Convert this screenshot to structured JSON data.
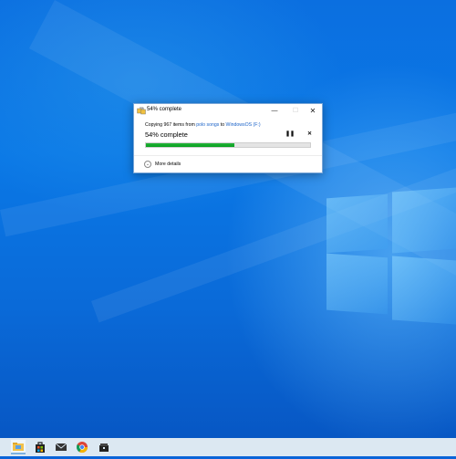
{
  "dialog": {
    "title": "54% complete",
    "minimize_glyph": "—",
    "maximize_glyph": "☐",
    "close_glyph": "✕",
    "copy_prefix": "Copying 967 items from ",
    "source": "polo songs",
    "copy_middle": " to ",
    "destination": "WindowsOS (F:)",
    "status": "54% complete",
    "progress_percent": 54,
    "pause_glyph": "❚❚",
    "cancel_glyph": "✕",
    "more_details_glyph": "⌄",
    "more_details": "More details",
    "progress_color": "#06a01e"
  },
  "taskbar": {
    "items": [
      "file-explorer-icon",
      "store-icon",
      "mail-icon",
      "chrome-icon",
      "app-icon"
    ],
    "background": "#dce8f2"
  }
}
